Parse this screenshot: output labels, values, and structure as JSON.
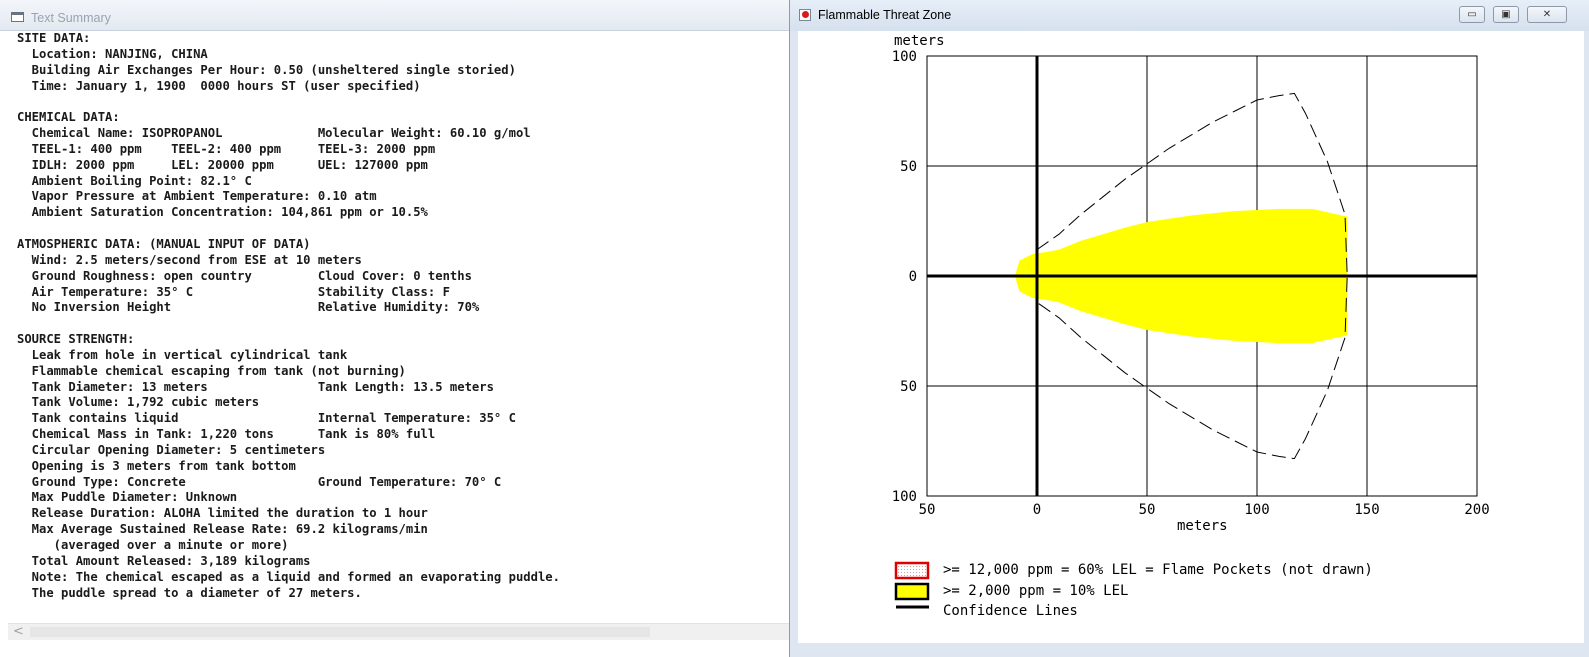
{
  "left_window": {
    "title": "Text Summary",
    "lines": [
      "SITE DATA:",
      "  Location: NANJING, CHINA",
      "  Building Air Exchanges Per Hour: 0.50 (unsheltered single storied)",
      "  Time: January 1, 1900  0000 hours ST (user specified)",
      "",
      "CHEMICAL DATA:",
      "  Chemical Name: ISOPROPANOL             Molecular Weight: 60.10 g/mol",
      "  TEEL-1: 400 ppm    TEEL-2: 400 ppm     TEEL-3: 2000 ppm",
      "  IDLH: 2000 ppm     LEL: 20000 ppm      UEL: 127000 ppm",
      "  Ambient Boiling Point: 82.1° C",
      "  Vapor Pressure at Ambient Temperature: 0.10 atm",
      "  Ambient Saturation Concentration: 104,861 ppm or 10.5%",
      "",
      "ATMOSPHERIC DATA: (MANUAL INPUT OF DATA)",
      "  Wind: 2.5 meters/second from ESE at 10 meters",
      "  Ground Roughness: open country         Cloud Cover: 0 tenths",
      "  Air Temperature: 35° C                 Stability Class: F",
      "  No Inversion Height                    Relative Humidity: 70%",
      "",
      "SOURCE STRENGTH:",
      "  Leak from hole in vertical cylindrical tank",
      "  Flammable chemical escaping from tank (not burning)",
      "  Tank Diameter: 13 meters               Tank Length: 13.5 meters",
      "  Tank Volume: 1,792 cubic meters",
      "  Tank contains liquid                   Internal Temperature: 35° C",
      "  Chemical Mass in Tank: 1,220 tons      Tank is 80% full",
      "  Circular Opening Diameter: 5 centimeters",
      "  Opening is 3 meters from tank bottom",
      "  Ground Type: Concrete                  Ground Temperature: 70° C",
      "  Max Puddle Diameter: Unknown",
      "  Release Duration: ALOHA limited the duration to 1 hour",
      "  Max Average Sustained Release Rate: 69.2 kilograms/min",
      "     (averaged over a minute or more)",
      "  Total Amount Released: 3,189 kilograms",
      "  Note: The chemical escaped as a liquid and formed an evaporating puddle.",
      "  The puddle spread to a diameter of 27 meters."
    ],
    "scroll_left_glyph": "<"
  },
  "right_window": {
    "title": "Flammable Threat Zone",
    "controls": {
      "minimize": "▭",
      "maximize": "▣",
      "close": "✕"
    }
  },
  "chart_data": {
    "type": "area",
    "xlabel": "meters",
    "ylabel": "meters",
    "xlim": [
      -50,
      200
    ],
    "ylim": [
      -100,
      100
    ],
    "x_ticks": [
      50,
      0,
      50,
      100,
      150,
      200
    ],
    "y_ticks": [
      100,
      50,
      0,
      50,
      100
    ],
    "grid": true,
    "series": [
      {
        "name": ">= 2,000 ppm = 10% LEL",
        "style": "filled",
        "color": "#ffff00",
        "x": [
          -10,
          -8,
          -2,
          5,
          10,
          20,
          30,
          40,
          50,
          60,
          70,
          80,
          90,
          100,
          110,
          125,
          141,
          141,
          125,
          110,
          100,
          90,
          80,
          70,
          60,
          50,
          40,
          30,
          20,
          10,
          5,
          -2,
          -8,
          -10
        ],
        "y": [
          0,
          7,
          10,
          11,
          12,
          16,
          19,
          22,
          24.5,
          26,
          27.5,
          28.5,
          29.5,
          30,
          30.5,
          30.5,
          27,
          -27,
          -30.5,
          -30.5,
          -30,
          -29.5,
          -28.5,
          -27.5,
          -26,
          -24.5,
          -22,
          -19,
          -16,
          -12,
          -11,
          -10,
          -7,
          0
        ]
      },
      {
        "name": "Confidence Lines",
        "style": "dashed",
        "color": "#000000",
        "x": [
          0,
          10,
          20,
          30,
          40,
          50,
          60,
          70,
          80,
          90,
          100,
          110,
          117,
          122,
          132,
          140,
          141,
          140,
          132,
          122,
          117,
          110,
          100,
          90,
          80,
          70,
          60,
          50,
          40,
          30,
          20,
          10,
          0
        ],
        "y": [
          12,
          19,
          28,
          36,
          44,
          51,
          58,
          64,
          70,
          75,
          80,
          82,
          83,
          74,
          52,
          28,
          0,
          -28,
          -52,
          -74,
          -83,
          -82,
          -80,
          -75,
          -70,
          -64,
          -58,
          -51,
          -44,
          -36,
          -28,
          -19,
          -12
        ]
      }
    ],
    "legend": [
      {
        "label": ">= 12,000 ppm = 60% LEL = Flame Pockets (not drawn)",
        "swatch": "red-dotted"
      },
      {
        "label": ">= 2,000 ppm = 10% LEL",
        "swatch": "yellow"
      },
      {
        "label": "Confidence Lines",
        "swatch": "line"
      }
    ],
    "legend_position": "bottom-left"
  }
}
